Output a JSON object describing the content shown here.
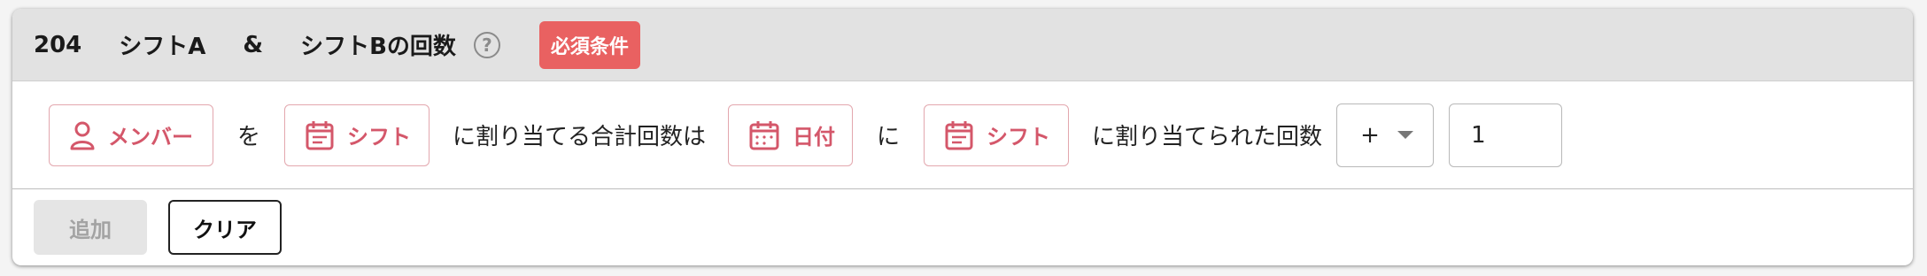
{
  "header": {
    "number": "204",
    "title_part1": "シフトA",
    "ampersand": "&",
    "title_part2": "シフトBの回数",
    "help_symbol": "?",
    "badge": "必須条件"
  },
  "condition": {
    "chip_member": "メンバー",
    "text_wo": "を",
    "chip_shift_1": "シフト",
    "text_total": "に割り当てる合計回数は",
    "chip_date": "日付",
    "text_ni": "に",
    "chip_shift_2": "シフト",
    "text_assigned": "に割り当てられた回数",
    "operator_value": "+",
    "count_value": "1"
  },
  "footer": {
    "add_label": "追加",
    "clear_label": "クリア"
  },
  "colors": {
    "accent": "#d4576a",
    "badge_bg": "#e96161",
    "header_bg": "#e2e2e2"
  }
}
